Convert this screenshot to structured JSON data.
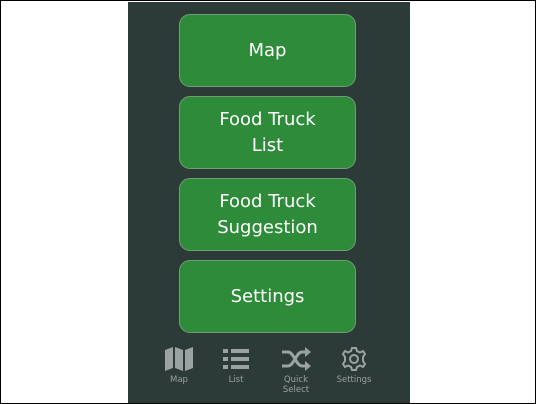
{
  "menu": {
    "map_label": "Map",
    "list_label": "Food Truck\nList",
    "suggestion_label": "Food Truck\nSuggestion",
    "settings_label": "Settings"
  },
  "tabbar": {
    "items": [
      {
        "label": "Map",
        "icon": "map-icon"
      },
      {
        "label": "List",
        "icon": "list-icon"
      },
      {
        "label": "Quick\nSelect",
        "icon": "shuffle-icon"
      },
      {
        "label": "Settings",
        "icon": "gear-icon"
      }
    ]
  },
  "colors": {
    "background": "#2c3a38",
    "button": "#2e8b3a",
    "tab_icon": "#9aa3a1"
  }
}
